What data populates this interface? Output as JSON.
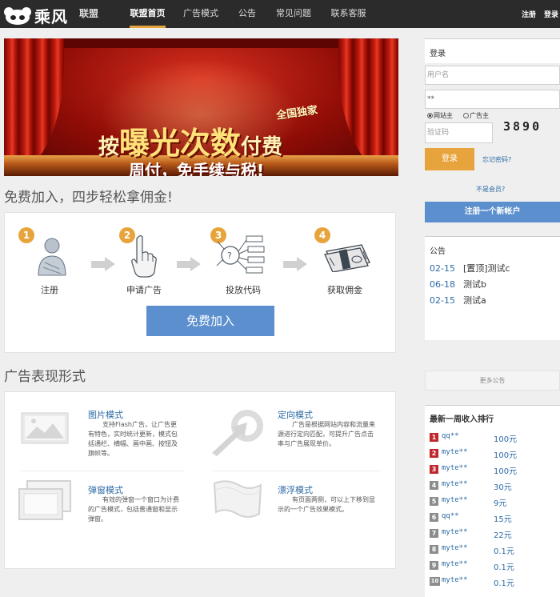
{
  "brand": {
    "name": "乘风",
    "sub": "联盟"
  },
  "nav": {
    "items": [
      "联盟首页",
      "广告模式",
      "公告",
      "常见问题",
      "联系客服"
    ],
    "active_index": 0
  },
  "top_links": {
    "register": "注册",
    "login": "登录"
  },
  "banner": {
    "tag": "全国独家",
    "line1_pre": "按",
    "line1_big": "曝光次数",
    "line1_post": "付费",
    "line2": "周付，免手续与税!"
  },
  "join_section": {
    "title": "免费加入，四步轻松拿佣金!",
    "steps": [
      {
        "num": "1",
        "label": "注册",
        "icon": "user-icon"
      },
      {
        "num": "2",
        "label": "申请广告",
        "icon": "click-hand-icon"
      },
      {
        "num": "3",
        "label": "投放代码",
        "icon": "code-nodes-icon"
      },
      {
        "num": "4",
        "label": "获取佣金",
        "icon": "money-icon"
      }
    ],
    "join_button": "免费加入"
  },
  "ad_forms": {
    "title": "广告表现形式",
    "items": [
      {
        "title": "图片模式",
        "desc": "支持Flash广告，让广告更有特色，实时统计更新，模式包括通栏、横幅、画中画、按钮及旗帜等。",
        "icon": "image-icon"
      },
      {
        "title": "定向模式",
        "desc": "广告是根据网站内容和流量来源进行定向匹配，可提升广告点击率与广告展现单价。",
        "icon": "target-arrow-icon"
      },
      {
        "title": "弹窗模式",
        "desc": "有效的弹窗一个窗口为计费的广告模式，包括普通窗和显示弹窗。",
        "icon": "popup-window-icon"
      },
      {
        "title": "漂浮模式",
        "desc": "有页面两侧，可以上下移到显示的一个广告效果模式。",
        "icon": "floating-flag-icon"
      }
    ]
  },
  "login": {
    "title": "登录",
    "username_placeholder": "用户名",
    "password_value": "**",
    "role_site": "网站主",
    "role_adv": "广告主",
    "captcha_placeholder": "验证码",
    "captcha_code": "3890",
    "login_button": "登录",
    "forgot": "忘记密码?",
    "not_member": "不是会员?",
    "register_button": "注册一个新帐户"
  },
  "notices": {
    "title": "公告",
    "items": [
      {
        "date": "02-15",
        "text": "[置顶]测试c"
      },
      {
        "date": "06-18",
        "text": "测试b"
      },
      {
        "date": "02-15",
        "text": "测试a"
      }
    ],
    "more": "更多公告"
  },
  "ranking": {
    "title": "最新一周收入排行",
    "rows": [
      {
        "rank": "1",
        "name": "qq**",
        "value": "100元"
      },
      {
        "rank": "2",
        "name": "myte**",
        "value": "100元"
      },
      {
        "rank": "3",
        "name": "myte**",
        "value": "100元"
      },
      {
        "rank": "4",
        "name": "myte**",
        "value": "30元"
      },
      {
        "rank": "5",
        "name": "myte**",
        "value": "9元"
      },
      {
        "rank": "6",
        "name": "qq**",
        "value": "15元"
      },
      {
        "rank": "7",
        "name": "myte**",
        "value": "22元"
      },
      {
        "rank": "8",
        "name": "myte**",
        "value": "0.1元"
      },
      {
        "rank": "9",
        "name": "myte**",
        "value": "0.1元"
      },
      {
        "rank": "10",
        "name": "myte**",
        "value": "0.1元"
      }
    ],
    "badge_colors": {
      "top": "#c0282d",
      "rest": "#8c8c8c"
    }
  },
  "colors": {
    "accent": "#e8a43c",
    "blue": "#5b8fcd",
    "link": "#2b6aa6",
    "nav_bg": "#2b2b2b"
  }
}
